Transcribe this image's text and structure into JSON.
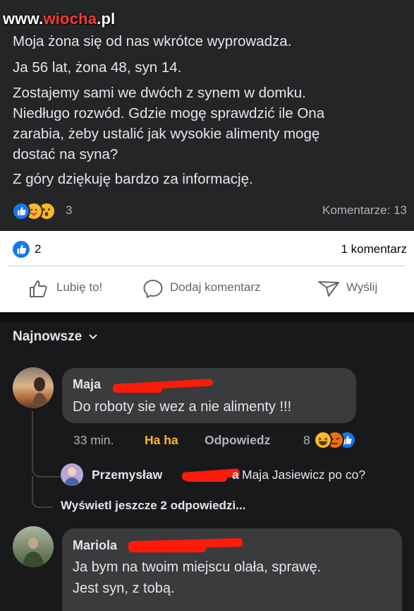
{
  "watermark": {
    "text_pre": "www.",
    "text_acc": "wiocha",
    "text_post": ".pl"
  },
  "post": {
    "lines": [
      "Moja żona się od nas wkrótce wyprowadza.",
      "Ja 56 lat, żona 48, syn 14.",
      "Zostajemy sami we dwóch z synem w domku.",
      "Niedługo rozwód. Gdzie mogę sprawdzić ile Ona",
      "zarabia, żeby ustalić jak wysokie alimenty mogę",
      "dostać na syna?",
      "Z góry dziękuję bardzo za informację."
    ],
    "reaction_count": "3",
    "comments_count": "Komentarze: 13",
    "reactions": [
      "like-icon",
      "care-icon",
      "wow-icon"
    ]
  },
  "share_card": {
    "like_count": "2",
    "comment_count": "1 komentarz",
    "actions": {
      "like": "Lubię to!",
      "comment": "Dodaj komentarz",
      "send": "Wyślij"
    }
  },
  "comments": {
    "sort_label": "Najnowsze",
    "items": [
      {
        "author": "Maja",
        "text": "Do roboty sie wez a nie alimenty !!!",
        "time": "33 min.",
        "reaction": "Ha ha",
        "reply": "Odpowiedz",
        "reaction_count": "8",
        "colors": {
          "haha": "#f7b928"
        }
      },
      {
        "author": "Mariola",
        "text_lines": [
          "Ja bym na twoim miejscu olała, sprawę.",
          "Jest syn, z tobą."
        ]
      }
    ],
    "reply": {
      "author": "Przemysław",
      "name_tail": "a",
      "text": "Maja Jasiewicz po co?"
    },
    "more_replies": "Wyświetl jeszcze 2 odpowiedzi..."
  },
  "colors": {
    "facebook_blue": "#1877f2",
    "redaction": "#ff1a0a"
  }
}
